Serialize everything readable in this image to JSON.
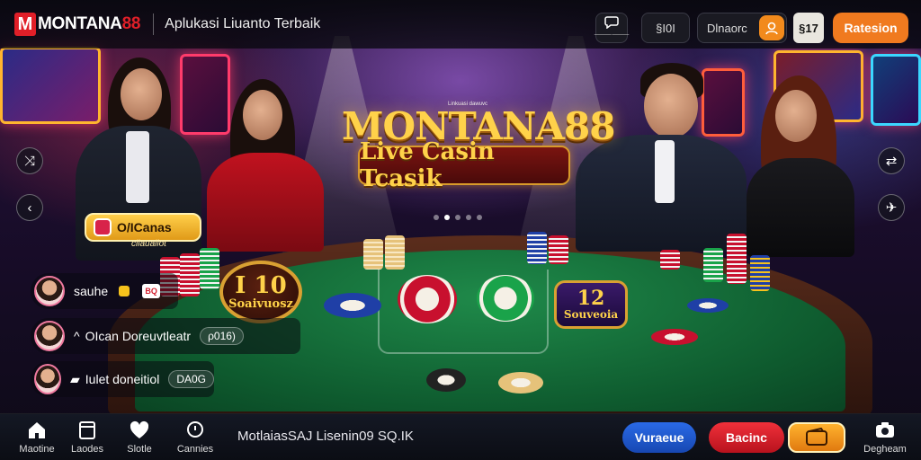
{
  "header": {
    "logo_mark": "M",
    "logo_word": "MONTANA",
    "logo_num": "88",
    "tagline": "Aplukasi Liuanto Terbaik",
    "icon_button_mini": "⸻⸻",
    "language_label": "§I0I",
    "search_label": "Dlnaorc",
    "gift_label": "§17",
    "register_label": "Ratesion"
  },
  "hero": {
    "kicker": "Linkuasi dawuvc",
    "title": "MONTANA88",
    "subtitle": "Live Casin Tcasik",
    "slides_total": 5,
    "active_slide": 1
  },
  "promos": {
    "pill_label": "O/ICanas",
    "pill_sub": "cllaualiot",
    "medal_left_big": "I 10",
    "medal_left_small": "Soaivuosz",
    "medal_right_big": "12",
    "medal_right_small": "Souveoia"
  },
  "feed": [
    {
      "text": "sauhe",
      "badge": "BQ"
    },
    {
      "text": "OIcan Doreuvtleatr",
      "tag": "ρ016)"
    },
    {
      "text": "Iulet doneitiol",
      "tag": "DA0G"
    }
  ],
  "bottom_nav": [
    {
      "label": "Maotine",
      "icon": "home-icon"
    },
    {
      "label": "Laodes",
      "icon": "tablet-icon"
    },
    {
      "label": "Slotle",
      "icon": "heart-icon"
    },
    {
      "label": "Cannies",
      "icon": "search-icon"
    }
  ],
  "ticker": "MotlaiasSAJ Lisenin09 SQ.IK",
  "actions": {
    "blue_label": "Vuraeue",
    "red_label": "Bacinc",
    "right_label": "Degheam"
  },
  "colors": {
    "brand_red": "#e01f28",
    "register_orange": "#f07a1f",
    "gold": "#ffd24a",
    "felt_green": "#1f8a4a",
    "action_blue": "#2a6ae6",
    "action_red": "#f0303a"
  }
}
